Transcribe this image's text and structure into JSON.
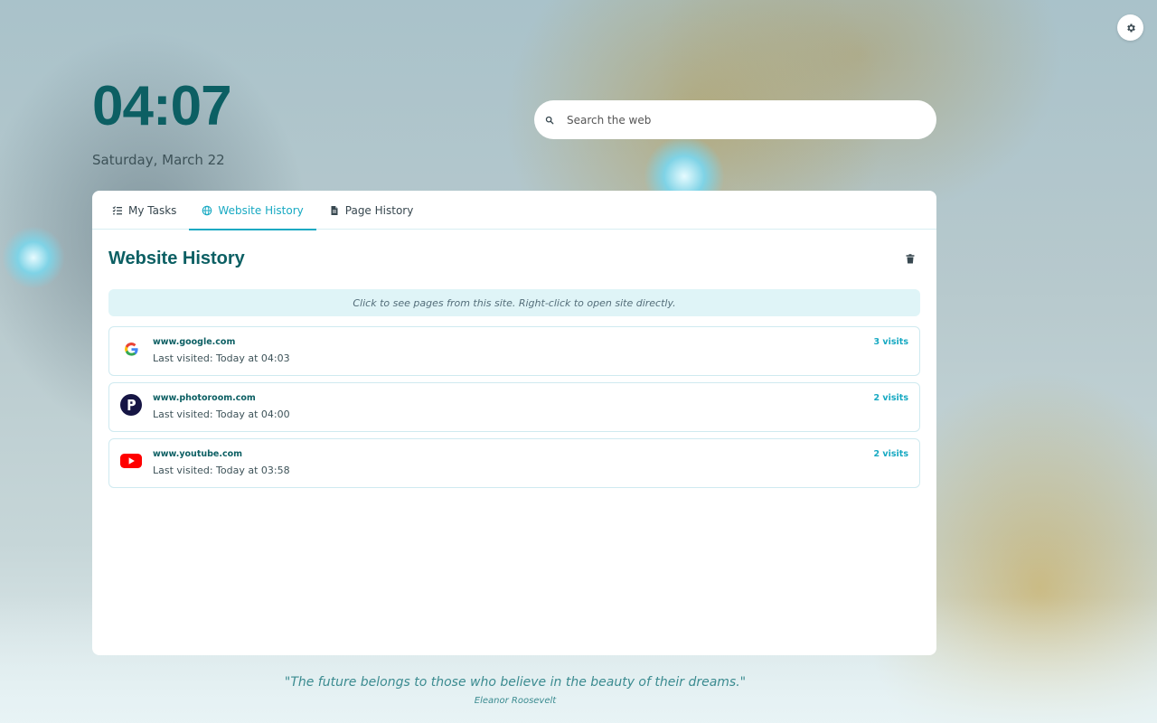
{
  "clock": {
    "time": "04:07",
    "date": "Saturday, March 22"
  },
  "search": {
    "placeholder": "Search the web"
  },
  "tabs": [
    {
      "label": "My Tasks",
      "icon": "list-check-icon"
    },
    {
      "label": "Website History",
      "icon": "globe-icon",
      "active": true
    },
    {
      "label": "Page History",
      "icon": "file-icon"
    }
  ],
  "history": {
    "title": "Website History",
    "hint": "Click to see pages from this site. Right-click to open site directly.",
    "sites": [
      {
        "domain": "www.google.com",
        "last_visited": "Last visited: Today at 04:03",
        "visits": "3 visits",
        "icon": "google-icon"
      },
      {
        "domain": "www.photoroom.com",
        "last_visited": "Last visited: Today at 04:00",
        "visits": "2 visits",
        "icon": "photoroom-icon"
      },
      {
        "domain": "www.youtube.com",
        "last_visited": "Last visited: Today at 03:58",
        "visits": "2 visits",
        "icon": "youtube-icon"
      }
    ]
  },
  "quote": {
    "text": "\"The future belongs to those who believe in the beauty of their dreams.\"",
    "author": "Eleanor Roosevelt"
  },
  "colors": {
    "accent": "#17a9c2",
    "primary": "#0c5f63"
  }
}
